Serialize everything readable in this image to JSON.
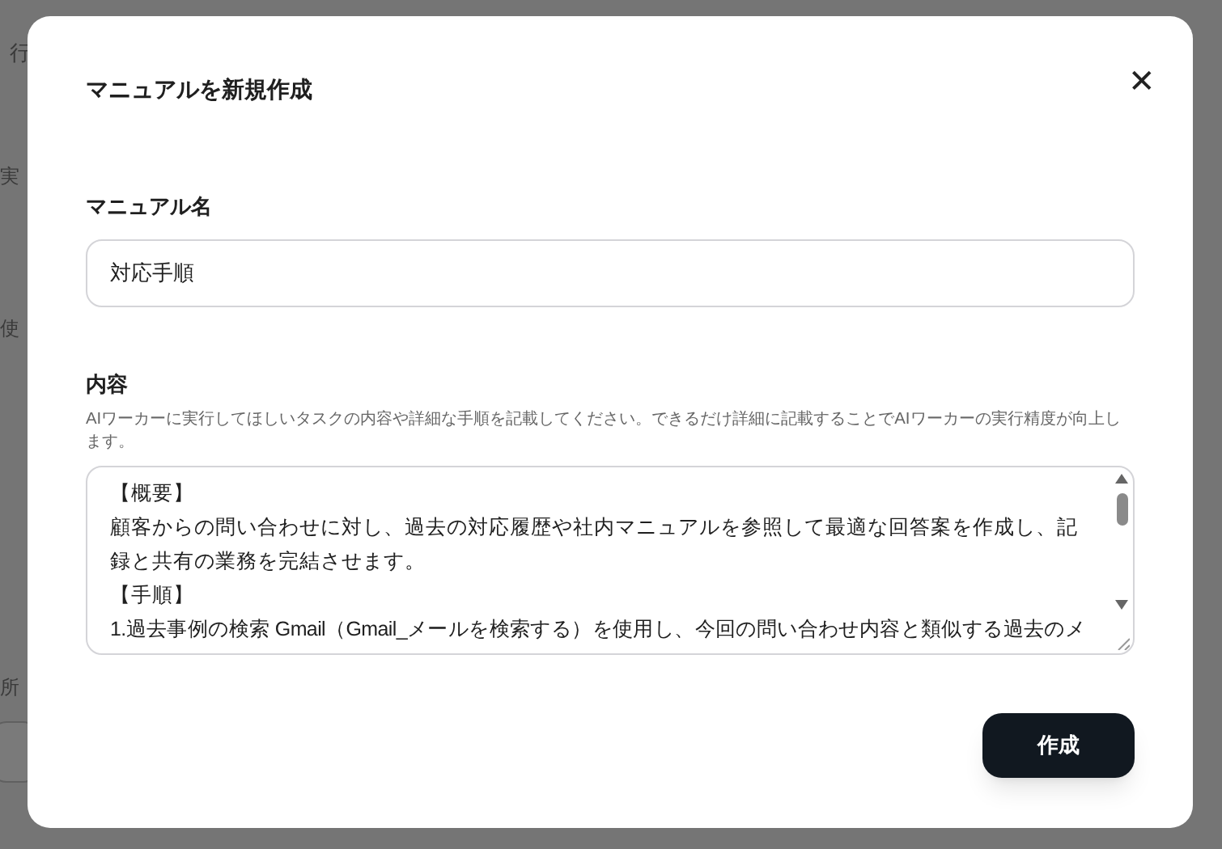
{
  "background": {
    "intro_lines": [
      "行"
    ],
    "labels": [
      "実",
      "使",
      "所"
    ]
  },
  "dialog": {
    "title": "マニュアルを新規作成",
    "close_label": "✕",
    "name_field": {
      "label": "マニュアル名",
      "value": "対応手順"
    },
    "content_field": {
      "label": "内容",
      "help": "AIワーカーに実行してほしいタスクの内容や詳細な手順を記載してください。できるだけ詳細に記載することでAIワーカーの実行精度が向上します。",
      "lines": [
        "【概要】",
        "顧客からの問い合わせに対し、過去の対応履歴や社内マニュアルを参照して最適な回答案を作成し、記録と共有の業務を完結させます。",
        "【手順】",
        "1.過去事例の検索 Gmail（Gmail_メールを検索する）を使用し、今回の問い合わせ内容と類似する過去のメ"
      ]
    },
    "submit_label": "作成"
  }
}
